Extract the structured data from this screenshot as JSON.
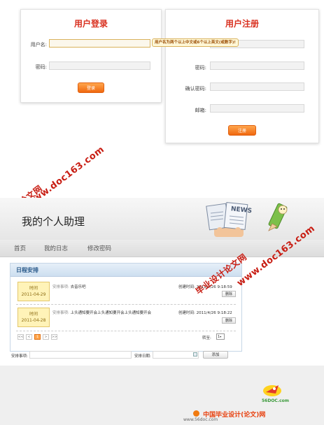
{
  "login": {
    "title": "用户登录",
    "username_label": "用户名:",
    "password_label": "密码:",
    "submit_label": "登录"
  },
  "register": {
    "title": "用户注册",
    "tooltip": "用户名为两个以上中文或6个以上英文(或数字)!",
    "password_label": "密码:",
    "confirm_label": "确认密码:",
    "email_label": "邮箱:",
    "submit_label": "注册"
  },
  "watermark": {
    "brand": "毕业设计论文网",
    "url": "www.doc163.com",
    "color": "#c81d13"
  },
  "app": {
    "title": "我的个人助理",
    "news_label": "NEWS",
    "nav": [
      "首页",
      "我的日志",
      "修改密码"
    ],
    "schedule": {
      "title": "日程安排",
      "rows": [
        {
          "time_label": "时间",
          "date": "2011-04-29",
          "item_label": "安排事项:",
          "item": "去音乐吧",
          "created_label": "创建时间:",
          "created": "2011/4/26 9:18:59",
          "delete_label": "删除"
        },
        {
          "time_label": "时间",
          "date": "2011-04-28",
          "item_label": "安排事项:",
          "item": "上头通知要开会上头通知要开会上头通知要开会",
          "created_label": "创建时间:",
          "created": "2011/4/26 9:18:22",
          "delete_label": "删除"
        }
      ],
      "pager": {
        "first": "<<",
        "prev": "<",
        "current": "1",
        "next": ">",
        "last": ">>",
        "goto_label": "转至:",
        "goto_value": "1"
      }
    },
    "add_form": {
      "item_label": "安排事项:",
      "date_label": "安排日期:",
      "add_label": "添加"
    }
  },
  "footer": {
    "logo_text": "56DOC.com",
    "brand_prefix": "中国",
    "brand": "毕业设计(论文)网",
    "url": "www.56doc.com"
  },
  "colors": {
    "accent_orange": "#f0680f",
    "title_red": "#d9301f",
    "header_blue": "#2a5a8a"
  }
}
